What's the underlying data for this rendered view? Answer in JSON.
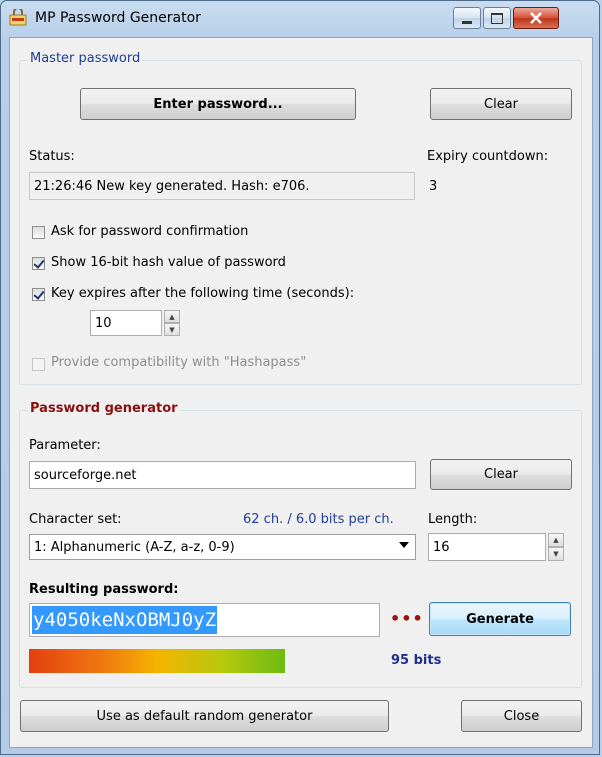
{
  "window": {
    "title": "MP Password Generator"
  },
  "master": {
    "group_label": "Master password",
    "enter_button": "Enter password...",
    "clear_button": "Clear",
    "status_label": "Status:",
    "status_value": "21:26:46 New key generated. Hash: e706.",
    "expiry_label": "Expiry countdown:",
    "expiry_value": "3",
    "ask_confirm": {
      "label": "Ask for password confirmation",
      "checked": false
    },
    "show_hash": {
      "label": "Show 16-bit hash value of password",
      "checked": true
    },
    "key_expires": {
      "label": "Key expires after the following time (seconds):",
      "checked": true
    },
    "expire_seconds": "10",
    "hashapass": {
      "label": "Provide compatibility with \"Hashapass\"",
      "checked": false,
      "disabled": true
    }
  },
  "generator": {
    "group_label": "Password generator",
    "parameter_label": "Parameter:",
    "parameter_value": "sourceforge.net",
    "clear_button": "Clear",
    "charset_label": "Character set:",
    "charset_info": "62 ch. / 6.0 bits per ch.",
    "charset_value": "1: Alphanumeric (A-Z, a-z, 0-9)",
    "length_label": "Length:",
    "length_value": "16",
    "result_label": "Resulting password:",
    "result_value": "y4050keNxOBMJ0yZ",
    "dots": "•••",
    "generate_button": "Generate",
    "strength_bits": "95 bits",
    "strength_fraction": 0.37
  },
  "footer": {
    "default_button": "Use as default random generator",
    "close_button": "Close"
  },
  "colors": {
    "group_title_master": "#1f3d99",
    "group_title_generator": "#8b1010",
    "charset_info": "#1f3d99",
    "selection": "#3399ff",
    "dots": "#a01010",
    "bits": "#1f2f8f"
  }
}
